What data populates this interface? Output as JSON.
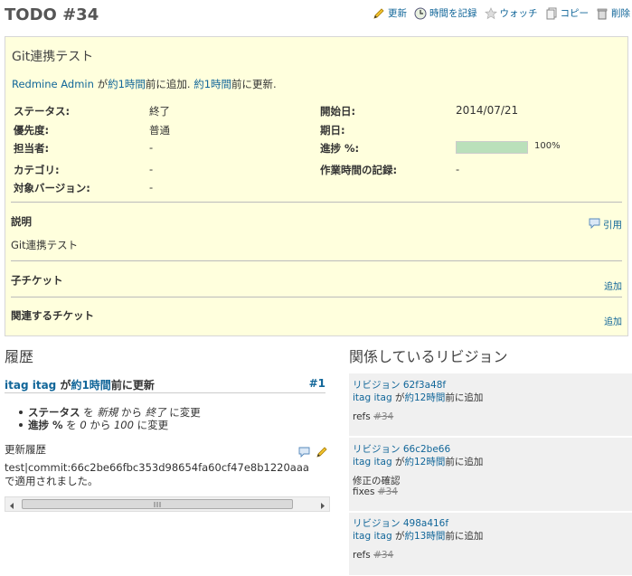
{
  "header": {
    "title": "TODO #34",
    "actions": {
      "edit": "更新",
      "log_time": "時間を記録",
      "watch": "ウォッチ",
      "copy": "コピー",
      "delete": "削除"
    }
  },
  "issue": {
    "subject": "Git連携テスト",
    "author_name": "Redmine Admin",
    "author_mid": " が",
    "added_link": "約1時間",
    "added_text": "前に追加. ",
    "updated_link": "約1時間",
    "updated_text": "前に更新.",
    "attributes": {
      "status_label": "ステータス:",
      "status_value": "終了",
      "priority_label": "優先度:",
      "priority_value": "普通",
      "assignee_label": "担当者:",
      "assignee_value": "-",
      "category_label": "カテゴリ:",
      "category_value": "-",
      "version_label": "対象バージョン:",
      "version_value": "-",
      "start_label": "開始日:",
      "start_value": "2014/07/21",
      "due_label": "期日:",
      "due_value": "",
      "progress_label": "進捗 %:",
      "progress_value": 100,
      "progress_text": "100%",
      "spent_label": "作業時間の記録:",
      "spent_value": "-"
    },
    "description_label": "説明",
    "quote_link": "引用",
    "description_text": "Git連携テスト",
    "subtasks_label": "子チケット",
    "subtasks_add": "追加",
    "relations_label": "関連するチケット",
    "relations_add": "追加"
  },
  "history": {
    "title": "履歴",
    "journal": {
      "user": "itag itag",
      "mid": " が",
      "time_link": "約1時間",
      "suffix": "前に更新",
      "number": "#1",
      "details": [
        {
          "field": "ステータス",
          "from_word": " を ",
          "old": "新規",
          "mid": " から ",
          "new": "終了",
          "end": " に変更"
        },
        {
          "field": "進捗 %",
          "from_word": " を ",
          "old": "0",
          "mid": " から ",
          "new": "100",
          "end": " に変更"
        }
      ],
      "notes_label": "更新履歴",
      "notes_line1": "test|commit:66c2be66fbc353d98654fa60cf47e8b1220aaa",
      "notes_line2": "で適用されました。"
    }
  },
  "revisions": {
    "title": "関係しているリビジョン",
    "items": [
      {
        "label": "リビジョン 62f3a48f",
        "user": "itag itag",
        "mid": " が",
        "time_link": "約12時間",
        "suffix": "前に追加",
        "msg1": "",
        "msg2_prefix": "refs ",
        "msg2_ref": "#34"
      },
      {
        "label": "リビジョン 66c2be66",
        "user": "itag itag",
        "mid": " が",
        "time_link": "約12時間",
        "suffix": "前に追加",
        "msg1": "修正の確認",
        "msg2_prefix": "fixes ",
        "msg2_ref": "#34"
      },
      {
        "label": "リビジョン 498a416f",
        "user": "itag itag",
        "mid": " が",
        "time_link": "約13時間",
        "suffix": "前に追加",
        "msg1": "",
        "msg2_prefix": "refs ",
        "msg2_ref": "#34"
      }
    ]
  },
  "colors": {
    "link": "#116699",
    "issue_bg": "#ffffdd",
    "progress_fill": "#bae0ba",
    "revision_bg": "#f0f0f0"
  }
}
